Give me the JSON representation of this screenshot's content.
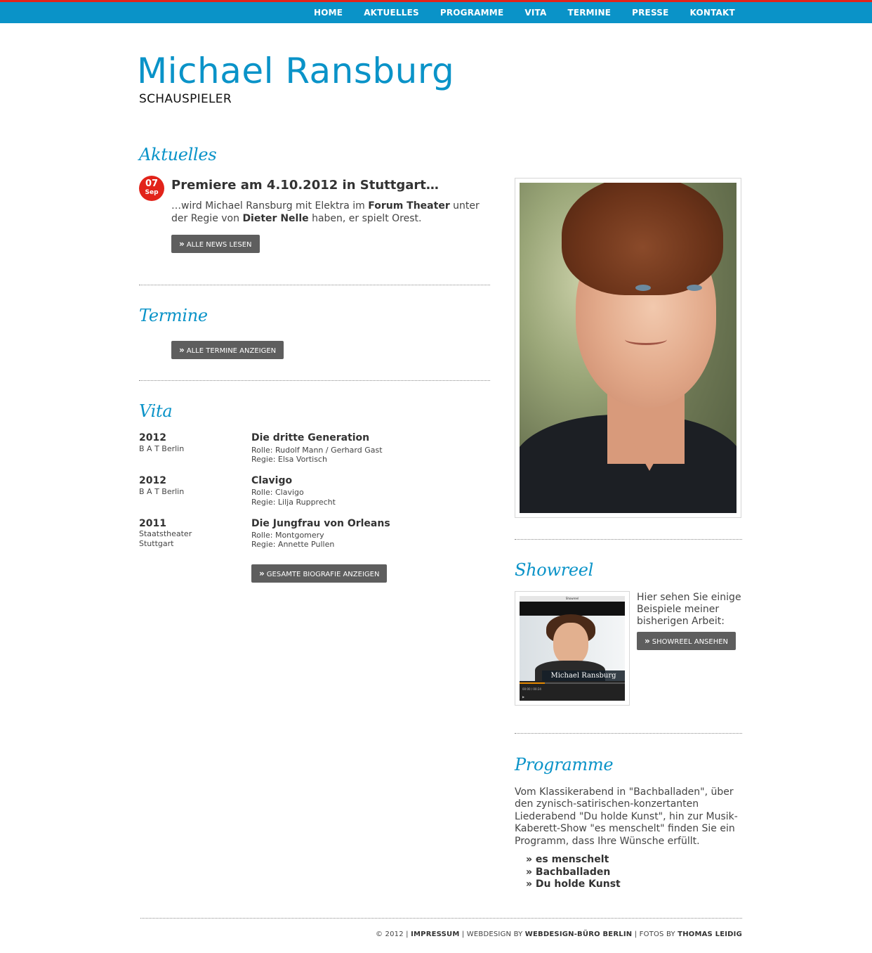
{
  "nav": {
    "items": [
      "HOME",
      "AKTUELLES",
      "PROGRAMME",
      "VITA",
      "TERMINE",
      "PRESSE",
      "KONTAKT"
    ]
  },
  "header": {
    "title": "Michael Ransburg",
    "subtitle": "SCHAUSPIELER"
  },
  "aktuelles": {
    "heading": "Aktuelles",
    "badge_day": "07",
    "badge_month": "Sep",
    "news_title": "Premiere am 4.10.2012 in Stuttgart…",
    "news_text_1": "…wird Michael Ransburg mit Elektra im ",
    "news_text_bold_1": "Forum Theater",
    "news_text_2": " unter der Regie von ",
    "news_text_bold_2": "Dieter Nelle",
    "news_text_3": " haben, er spielt Orest.",
    "button": "ALLE NEWS LESEN"
  },
  "termine": {
    "heading": "Termine",
    "button": "ALLE TERMINE ANZEIGEN"
  },
  "vita": {
    "heading": "Vita",
    "entries": [
      {
        "year": "2012",
        "place": "B A T Berlin",
        "title": "Die dritte Generation",
        "rolle": "Rolle: Rudolf Mann / Gerhard Gast",
        "regie": "Regie: Elsa Vortisch"
      },
      {
        "year": "2012",
        "place": "B A T Berlin",
        "title": "Clavigo",
        "rolle": "Rolle: Clavigo",
        "regie": "Regie: Lilja Rupprecht"
      },
      {
        "year": "2011",
        "place": "Staatstheater Stuttgart",
        "title": "Die Jungfrau von Orleans",
        "rolle": "Rolle: Montgomery",
        "regie": "Regie: Annette Pullen"
      }
    ],
    "button": "GESAMTE BIOGRAFIE ANZEIGEN"
  },
  "showreel": {
    "heading": "Showreel",
    "video_title": "Showreel",
    "video_caption": "Michael Ransburg",
    "video_time": "00:00 / 00:24",
    "video_progress": 0.24,
    "text": "Hier sehen Sie einige Beispiele meiner bisherigen Arbeit:",
    "button": "SHOWREEL ANSEHEN"
  },
  "programme": {
    "heading": "Programme",
    "text": "Vom Klassikerabend in \"Bachballaden\", über den zynisch-satirischen-konzertanten Liederabend \"Du holde Kunst\", hin zur Musik-Kaberett-Show \"es menschelt\" finden Sie ein Programm, dass Ihre Wünsche erfüllt.",
    "items": [
      "» es menschelt",
      "» Bachballaden",
      "» Du holde Kunst"
    ]
  },
  "footer": {
    "copyright": "© 2012 | ",
    "impressum": "IMPRESSUM",
    "webdesign_label": " | WEBDESIGN BY ",
    "webdesign": "WEBDESIGN-BÜRO BERLIN",
    "fotos_label": " | FOTOS BY ",
    "fotos": "THOMAS LEIDIG"
  },
  "colors": {
    "accent": "#0a93c8",
    "topline": "#e2231a",
    "button": "#5e5e5e"
  }
}
